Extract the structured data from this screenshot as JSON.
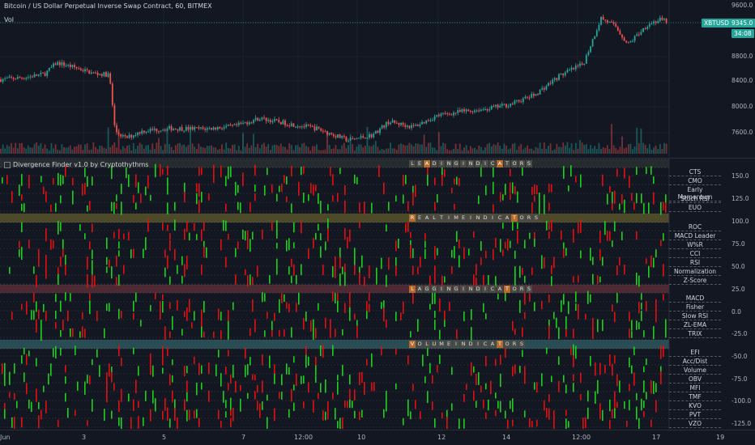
{
  "price_pane": {
    "title": "Bitcoin / US Dollar Perpetual Inverse Swap Contract, 60, BITMEX",
    "vol_label": "Vol",
    "symbol_tag": "XBTUSD",
    "last_price": "9345.0",
    "countdown": "34:08",
    "axis_ticks": [
      "9600.0",
      "8800.0",
      "8400.0",
      "8000.0",
      "7600.0"
    ],
    "colors": {
      "up": "#26a69a",
      "down": "#ef5350",
      "tag_bg": "#26a69a"
    }
  },
  "indicator_pane": {
    "title": "Divergence Finder v1.0 by Cryptothythms",
    "axis_ticks": [
      "150.0",
      "125.0",
      "100.0",
      "75.0",
      "50.0",
      "25.0",
      "0.0",
      "-25.0",
      "-50.0",
      "-75.0",
      "-100.0",
      "-125.0"
    ],
    "sections": [
      {
        "title": "LEADINGINDICATORS",
        "highlight": [
          2,
          12
        ],
        "band_color": "#262b2d",
        "indicators": [
          "CTS",
          "CMO",
          "Early Momentum",
          "Stoch RSI",
          "EUO"
        ]
      },
      {
        "title": "REALTIMEINDICATORS",
        "highlight": [
          0,
          14
        ],
        "band_color": "#4d4a2a",
        "indicators": [
          "ROC",
          "MACD Leader",
          "W%R",
          "CCI",
          "RSI",
          "Normalization",
          "Z-Score"
        ]
      },
      {
        "title": "LAGGINGINDICATORS",
        "highlight": [
          0,
          13
        ],
        "band_color": "#4d2a33",
        "indicators": [
          "MACD",
          "Fisher",
          "Slow RSI",
          "ZL-EMA",
          "TRIX"
        ]
      },
      {
        "title": "VOLUMEINDICATORS",
        "highlight": [
          0,
          12
        ],
        "band_color": "#2a4d55",
        "indicators": [
          "EFI",
          "Acc/Dist",
          "Volume",
          "OBV",
          "MFI",
          "TMF",
          "KVO",
          "PVT",
          "VZO"
        ]
      }
    ],
    "colors": {
      "green": "#1fd11f",
      "red": "#e01010"
    }
  },
  "time_axis": {
    "labels": [
      "Jun",
      "3",
      "5",
      "7",
      "12:00",
      "10",
      "12",
      "14",
      "12:00",
      "17",
      "19"
    ]
  }
}
